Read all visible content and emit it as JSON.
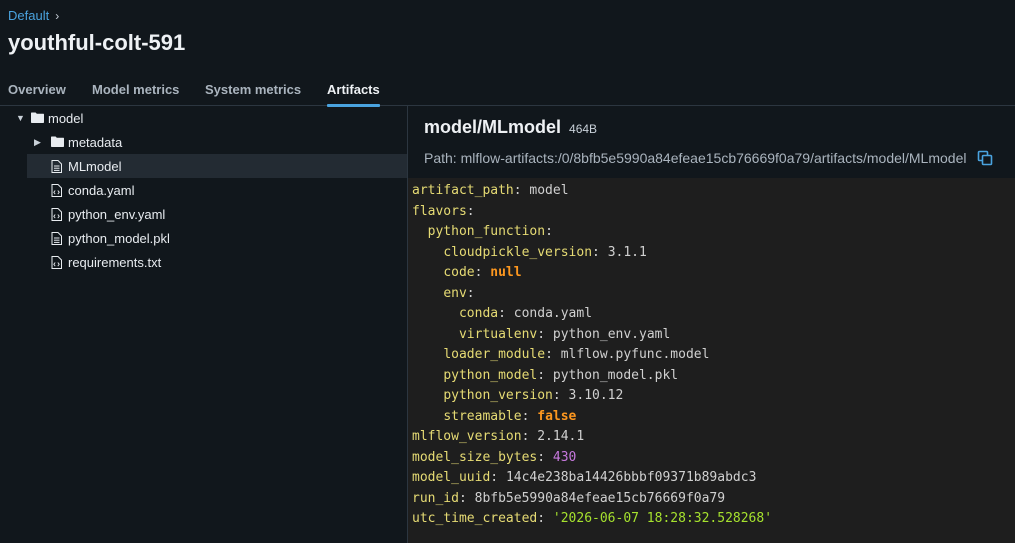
{
  "breadcrumb": {
    "parent": "Default"
  },
  "title": "youthful-colt-591",
  "tabs": [
    {
      "label": "Overview"
    },
    {
      "label": "Model metrics"
    },
    {
      "label": "System metrics"
    },
    {
      "label": "Artifacts",
      "active": true
    }
  ],
  "tree": {
    "root": "model",
    "items": [
      {
        "label": "metadata",
        "type": "folder"
      },
      {
        "label": "MLmodel",
        "type": "file",
        "selected": true
      },
      {
        "label": "conda.yaml",
        "type": "file"
      },
      {
        "label": "python_env.yaml",
        "type": "file"
      },
      {
        "label": "python_model.pkl",
        "type": "file"
      },
      {
        "label": "requirements.txt",
        "type": "file"
      }
    ]
  },
  "viewer": {
    "title": "model/MLmodel",
    "size": "464B",
    "path_label": "Path:",
    "path": "mlflow-artifacts:/0/8bfb5e5990a84efeae15cb76669f0a79/artifacts/model/MLmodel",
    "lines": [
      {
        "key": "artifact_path",
        "value": "model",
        "type": "plain"
      },
      {
        "key": "flavors",
        "value": "",
        "type": "plain"
      },
      {
        "key": "python_function",
        "value": "",
        "type": "plain"
      },
      {
        "key": "cloudpickle_version",
        "value": "3.1.1",
        "type": "plain"
      },
      {
        "key": "code",
        "value": "null",
        "type": "keyword"
      },
      {
        "key": "env",
        "value": "",
        "type": "plain"
      },
      {
        "key": "conda",
        "value": "conda.yaml",
        "type": "plain"
      },
      {
        "key": "virtualenv",
        "value": "python_env.yaml",
        "type": "plain"
      },
      {
        "key": "loader_module",
        "value": "mlflow.pyfunc.model",
        "type": "plain"
      },
      {
        "key": "python_model",
        "value": "python_model.pkl",
        "type": "plain"
      },
      {
        "key": "python_version",
        "value": "3.10.12",
        "type": "plain"
      },
      {
        "key": "streamable",
        "value": "false",
        "type": "keyword"
      },
      {
        "key": "mlflow_version",
        "value": "2.14.1",
        "type": "plain"
      },
      {
        "key": "model_size_bytes",
        "value": "430",
        "type": "number"
      },
      {
        "key": "model_uuid",
        "value": "14c4e238ba14426bbbf09371b89abdc3",
        "type": "plain"
      },
      {
        "key": "run_id",
        "value": "8bfb5e5990a84efeae15cb76669f0a79",
        "type": "plain"
      },
      {
        "key": "utc_time_created",
        "value": "'2026-06-07 18:28:32.528268'",
        "type": "string"
      }
    ]
  },
  "colors": {
    "accent": "#4aa3df",
    "key": "#e6db74",
    "keyword": "#fd971f",
    "number": "#c678dd",
    "string": "#a6e22e"
  }
}
